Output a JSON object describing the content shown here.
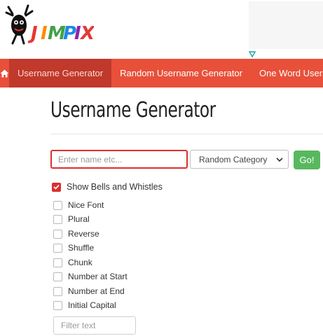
{
  "logo": {
    "text": "JIMPIX"
  },
  "nav": {
    "home_icon": "home-icon",
    "items": [
      "Username Generator",
      "Random Username Generator",
      "One Word Usernam"
    ]
  },
  "page": {
    "title": "Username Generator"
  },
  "form": {
    "name_placeholder": "Enter name etc...",
    "category_selected": "Random Category",
    "go_label": "Go!"
  },
  "options": {
    "show_bells": {
      "label": "Show Bells and Whistles",
      "checked": true
    },
    "items": [
      {
        "label": "Nice Font",
        "checked": false
      },
      {
        "label": "Plural",
        "checked": false
      },
      {
        "label": "Reverse",
        "checked": false
      },
      {
        "label": "Shuffle",
        "checked": false
      },
      {
        "label": "Chunk",
        "checked": false
      },
      {
        "label": "Number at Start",
        "checked": false
      },
      {
        "label": "Number at End",
        "checked": false
      },
      {
        "label": "Initial Capital",
        "checked": false
      }
    ]
  },
  "filter": {
    "placeholder": "Filter text"
  },
  "colors": {
    "nav_bg": "#e8503a",
    "nav_active": "#c0392b",
    "accent_red": "#d9302c",
    "go_green": "#58b85f"
  }
}
